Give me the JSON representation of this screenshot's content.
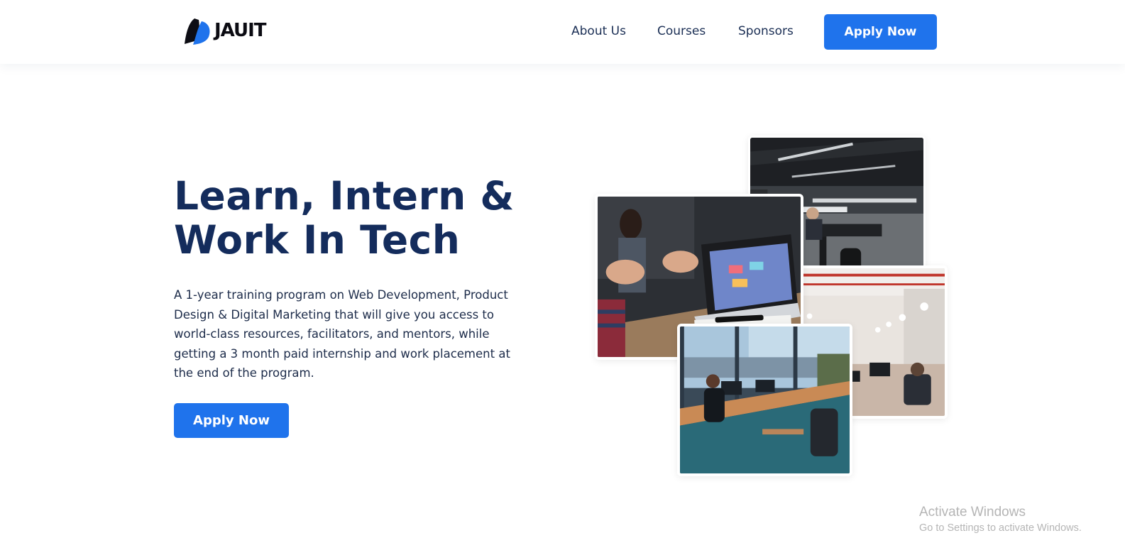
{
  "header": {
    "brand": "JAUIT",
    "logo_icon": "feather-logo-icon",
    "nav": [
      {
        "label": "About Us"
      },
      {
        "label": "Courses"
      },
      {
        "label": "Sponsors"
      }
    ],
    "cta_label": "Apply Now"
  },
  "hero": {
    "title_line1": "Learn, Intern &",
    "title_line2": "Work In Tech",
    "description": "A 1-year training program on Web Development, Product Design & Digital Marketing that will give you access to world-class resources, facilitators, and mentors, while getting a 3 month paid internship and work placement at the end of the program.",
    "cta_label": "Apply Now"
  },
  "gallery": {
    "images": [
      "open-plan-office-photo",
      "loft-workspace-photo",
      "laptop-meeting-photo",
      "city-view-office-photo"
    ]
  },
  "system_overlay": {
    "title": "Activate Windows",
    "subtitle": "Go to Settings to activate Windows."
  },
  "colors": {
    "primary": "#1f73ec",
    "heading": "#142c5c",
    "text": "#1d2c4a",
    "watermark": "#b5b5b5"
  }
}
